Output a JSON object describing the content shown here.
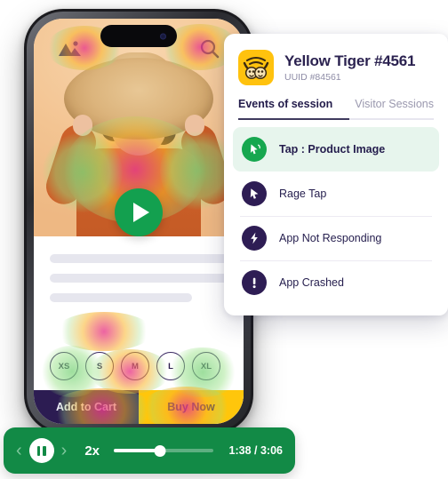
{
  "panel": {
    "avatar_icon": "tiger-face-icon",
    "title": "Yellow Tiger #4561",
    "uuid": "UUID #84561",
    "tabs": [
      {
        "label": "Events of session",
        "active": true
      },
      {
        "label": "Visitor Sessions",
        "active": false
      }
    ],
    "events": [
      {
        "label": "Tap : Product Image",
        "icon": "cursor-tap-icon",
        "selected": true,
        "color": "#16a74f"
      },
      {
        "label": "Rage Tap",
        "icon": "cursor-icon",
        "selected": false,
        "color": "#2e1d54"
      },
      {
        "label": "App Not Responding",
        "icon": "lightning-bolt-icon",
        "selected": false,
        "color": "#2e1d54"
      },
      {
        "label": "App Crashed",
        "icon": "exclamation-icon",
        "selected": false,
        "color": "#2e1d54"
      }
    ]
  },
  "phone": {
    "top_icons": [
      {
        "name": "image-icon"
      },
      {
        "name": "search-icon"
      }
    ],
    "play_button": "play-icon",
    "sizes": [
      "XS",
      "S",
      "M",
      "L",
      "XL"
    ],
    "cta": {
      "add_to_cart": "Add to Cart",
      "buy_now": "Buy Now"
    }
  },
  "player": {
    "prev_label": "‹",
    "next_label": "›",
    "pause_icon": "pause-icon",
    "speed": "2x",
    "progress_percent": 47,
    "time": "1:38 / 3:06"
  },
  "colors": {
    "brand_green": "#128a46",
    "accent_green": "#16a74f",
    "purple": "#2e1d54",
    "yellow": "#ffc60b",
    "selected_row": "#e7f5ed"
  }
}
